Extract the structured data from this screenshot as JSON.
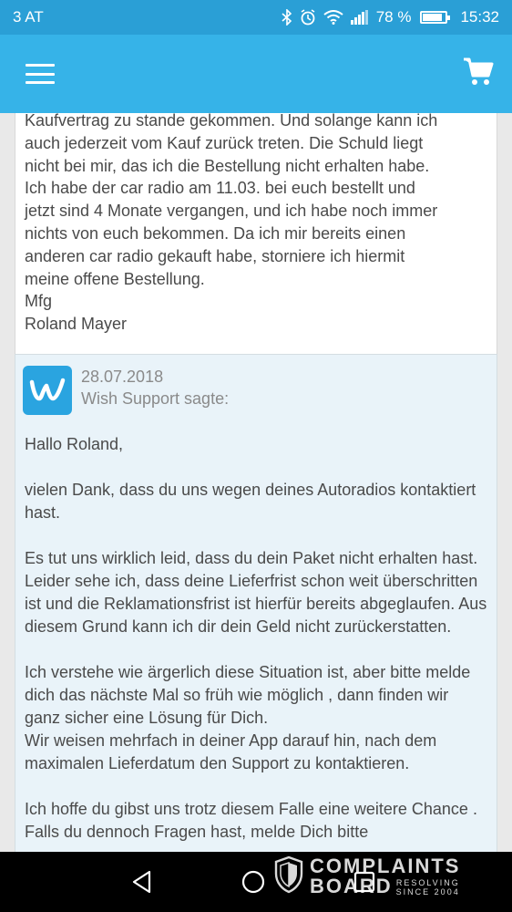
{
  "status_bar": {
    "carrier": "3 AT",
    "battery_percent": "78 %",
    "battery_level": 0.78,
    "time": "15:32",
    "icons": [
      "bluetooth-icon",
      "alarm-icon",
      "wifi-icon",
      "signal-icon",
      "battery-icon"
    ]
  },
  "app_bar": {
    "menu_icon": "hamburger-menu-icon",
    "cart_icon": "shopping-cart-icon",
    "accent": "#36b3e8"
  },
  "customer_message": {
    "lines": [
      "Kaufvertrag zu stande gekommen. Und solange kann ich",
      "auch jederzeit vom Kauf zurück treten. Die Schuld liegt",
      "nicht bei mir, das ich die Bestellung nicht erhalten habe.",
      "Ich habe der car radio am 11.03. bei euch bestellt und",
      "jetzt sind 4 Monate vergangen, und ich habe noch immer",
      "nichts von euch bekommen. Da ich mir bereits einen",
      "anderen car radio gekauft habe, storniere ich hiermit",
      "meine offene Bestellung.",
      "Mfg",
      "Roland Mayer"
    ]
  },
  "support_reply": {
    "date": "28.07.2018",
    "sender": "Wish Support sagte:",
    "paragraphs": [
      "Hallo Roland,",
      "vielen Dank, dass du uns wegen deines Autoradios kontaktiert hast.",
      "Es tut uns wirklich leid, dass du dein Paket nicht erhalten hast. Leider sehe ich, dass deine Lieferfrist schon weit überschritten ist und die Reklamationsfrist ist hierfür bereits abgeglaufen. Aus diesem Grund kann ich dir dein Geld nicht zurückerstatten.",
      "Ich verstehe wie ärgerlich diese Situation ist, aber bitte melde dich das nächste Mal so früh wie möglich , dann finden wir ganz sicher eine Lösung für Dich.\nWir weisen mehrfach in deiner App darauf hin, nach dem maximalen Lieferdatum den Support zu kontaktieren.",
      "Ich hoffe du gibst uns trotz diesem Falle eine weitere Chance . Falls du dennoch Fragen hast, melde Dich bitte"
    ]
  },
  "nav_bar": {
    "icons": [
      "back-icon",
      "home-icon",
      "recents-icon"
    ]
  },
  "watermark": {
    "title_line1": "COMPLAINTS",
    "title_line2": "BOARD",
    "tag_line1": "RESOLVING",
    "tag_line2": "SINCE 2004"
  }
}
